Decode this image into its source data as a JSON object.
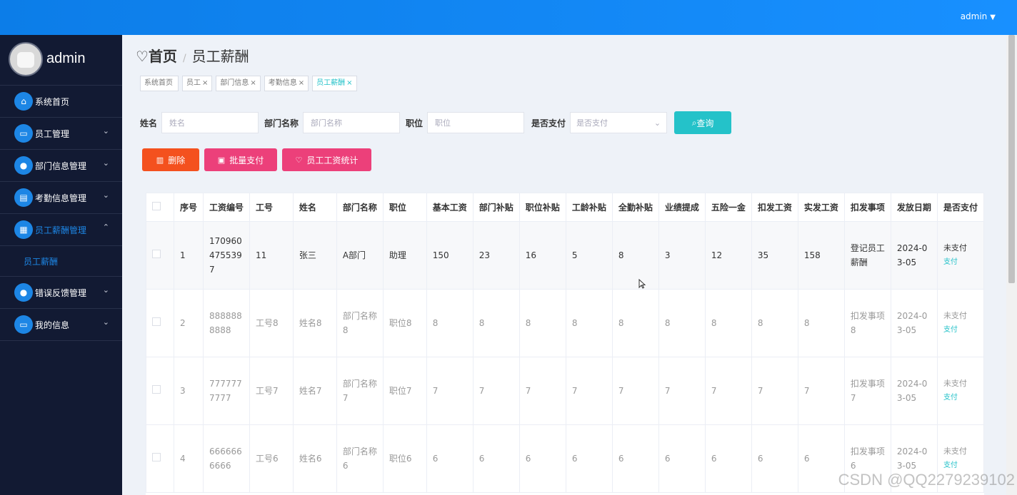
{
  "header": {
    "username": "admin",
    "caret": "▼"
  },
  "sidebar": {
    "avatar_name": "admin",
    "items": [
      {
        "label": "系统首页",
        "icon": "home-icon",
        "glyph": "⌂",
        "chevron": ""
      },
      {
        "label": "员工管理",
        "icon": "monitor-icon",
        "glyph": "▭",
        "chevron": "⌄"
      },
      {
        "label": "部门信息管理",
        "icon": "user-icon",
        "glyph": "●",
        "chevron": "⌄"
      },
      {
        "label": "考勤信息管理",
        "icon": "clipboard-icon",
        "glyph": "▤",
        "chevron": "⌄"
      },
      {
        "label": "员工薪酬管理",
        "icon": "chart-icon",
        "glyph": "▦",
        "chevron": "⌃"
      },
      {
        "label": "错误反馈管理",
        "icon": "bulb-icon",
        "glyph": "●",
        "chevron": "⌄"
      },
      {
        "label": "我的信息",
        "icon": "card-icon",
        "glyph": "▭",
        "chevron": "⌄"
      }
    ],
    "subitem": "员工薪酬"
  },
  "breadcrumb": {
    "home": "首页",
    "separator": "/",
    "current": "员工薪酬",
    "heart": "♡"
  },
  "tags": [
    {
      "label": "系统首页",
      "close": ""
    },
    {
      "label": "员工",
      "close": "×"
    },
    {
      "label": "部门信息",
      "close": "×"
    },
    {
      "label": "考勤信息",
      "close": "×"
    },
    {
      "label": "员工薪酬",
      "close": "×"
    }
  ],
  "search": {
    "name_label": "姓名",
    "name_placeholder": "姓名",
    "dept_label": "部门名称",
    "dept_placeholder": "部门名称",
    "position_label": "职位",
    "position_placeholder": "职位",
    "paid_label": "是否支付",
    "paid_placeholder": "是否支付",
    "query_label": "查询"
  },
  "actions": {
    "delete": "删除",
    "batch_pay": "批量支付",
    "stats": "员工工资统计"
  },
  "table": {
    "columns": [
      "序号",
      "工资编号",
      "工号",
      "姓名",
      "部门名称",
      "职位",
      "基本工资",
      "部门补贴",
      "职位补贴",
      "工龄补贴",
      "全勤补贴",
      "业绩提成",
      "五险一金",
      "扣发工资",
      "实发工资",
      "扣发事项",
      "发放日期",
      "是否支付"
    ],
    "rows": [
      [
        "1",
        "1709604755397",
        "11",
        "张三",
        "A部门",
        "助理",
        "150",
        "23",
        "16",
        "5",
        "8",
        "3",
        "12",
        "35",
        "158",
        "登记员工薪酬",
        "2024-03-05",
        "未支付"
      ],
      [
        "2",
        "8888888888",
        "工号8",
        "姓名8",
        "部门名称8",
        "职位8",
        "8",
        "8",
        "8",
        "8",
        "8",
        "8",
        "8",
        "8",
        "8",
        "扣发事项8",
        "2024-03-05",
        "未支付"
      ],
      [
        "3",
        "7777777777",
        "工号7",
        "姓名7",
        "部门名称7",
        "职位7",
        "7",
        "7",
        "7",
        "7",
        "7",
        "7",
        "7",
        "7",
        "7",
        "扣发事项7",
        "2024-03-05",
        "未支付"
      ],
      [
        "4",
        "6666666666",
        "工号6",
        "姓名6",
        "部门名称6",
        "职位6",
        "6",
        "6",
        "6",
        "6",
        "6",
        "6",
        "6",
        "6",
        "6",
        "扣发事项6",
        "2024-03-05",
        "未支付"
      ]
    ],
    "pay_link": "支付"
  },
  "watermark": "CSDN @QQ2279239102",
  "colors": {
    "topbar": "#1890ff",
    "sidebar": "#121a33",
    "accent": "#24c2c9",
    "danger": "#f4511e",
    "pink": "#ec407a"
  }
}
